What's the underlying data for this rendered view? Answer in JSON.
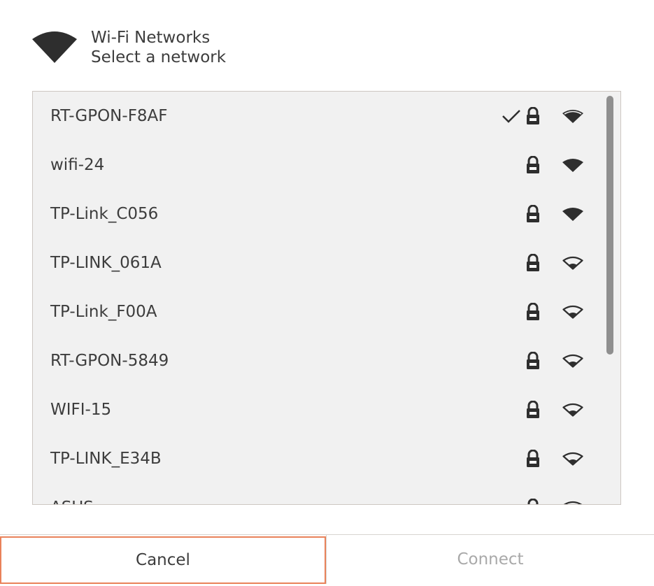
{
  "dialog": {
    "title": "Wi-Fi Networks",
    "subtitle": "Select a network",
    "icon": "wifi-signal-icon"
  },
  "networks": [
    {
      "ssid": "RT-GPON-F8AF",
      "connected": true,
      "secured": true,
      "signal": "good"
    },
    {
      "ssid": "wifi-24",
      "connected": false,
      "secured": true,
      "signal": "excellent"
    },
    {
      "ssid": "TP-Link_C056",
      "connected": false,
      "secured": true,
      "signal": "excellent"
    },
    {
      "ssid": "TP-LINK_061A",
      "connected": false,
      "secured": true,
      "signal": "weak"
    },
    {
      "ssid": "TP-Link_F00A",
      "connected": false,
      "secured": true,
      "signal": "weak"
    },
    {
      "ssid": "RT-GPON-5849",
      "connected": false,
      "secured": true,
      "signal": "weak"
    },
    {
      "ssid": "WIFI-15",
      "connected": false,
      "secured": true,
      "signal": "weak"
    },
    {
      "ssid": "TP-LINK_E34B",
      "connected": false,
      "secured": true,
      "signal": "weak"
    },
    {
      "ssid": "ASUS",
      "connected": false,
      "secured": true,
      "signal": "weak"
    }
  ],
  "buttons": {
    "cancel": "Cancel",
    "connect": "Connect"
  },
  "colors": {
    "accent_border": "#e9825a",
    "text": "#3d3d3d",
    "disabled_text": "#a9a9a9",
    "list_bg": "#f1f1f1"
  }
}
